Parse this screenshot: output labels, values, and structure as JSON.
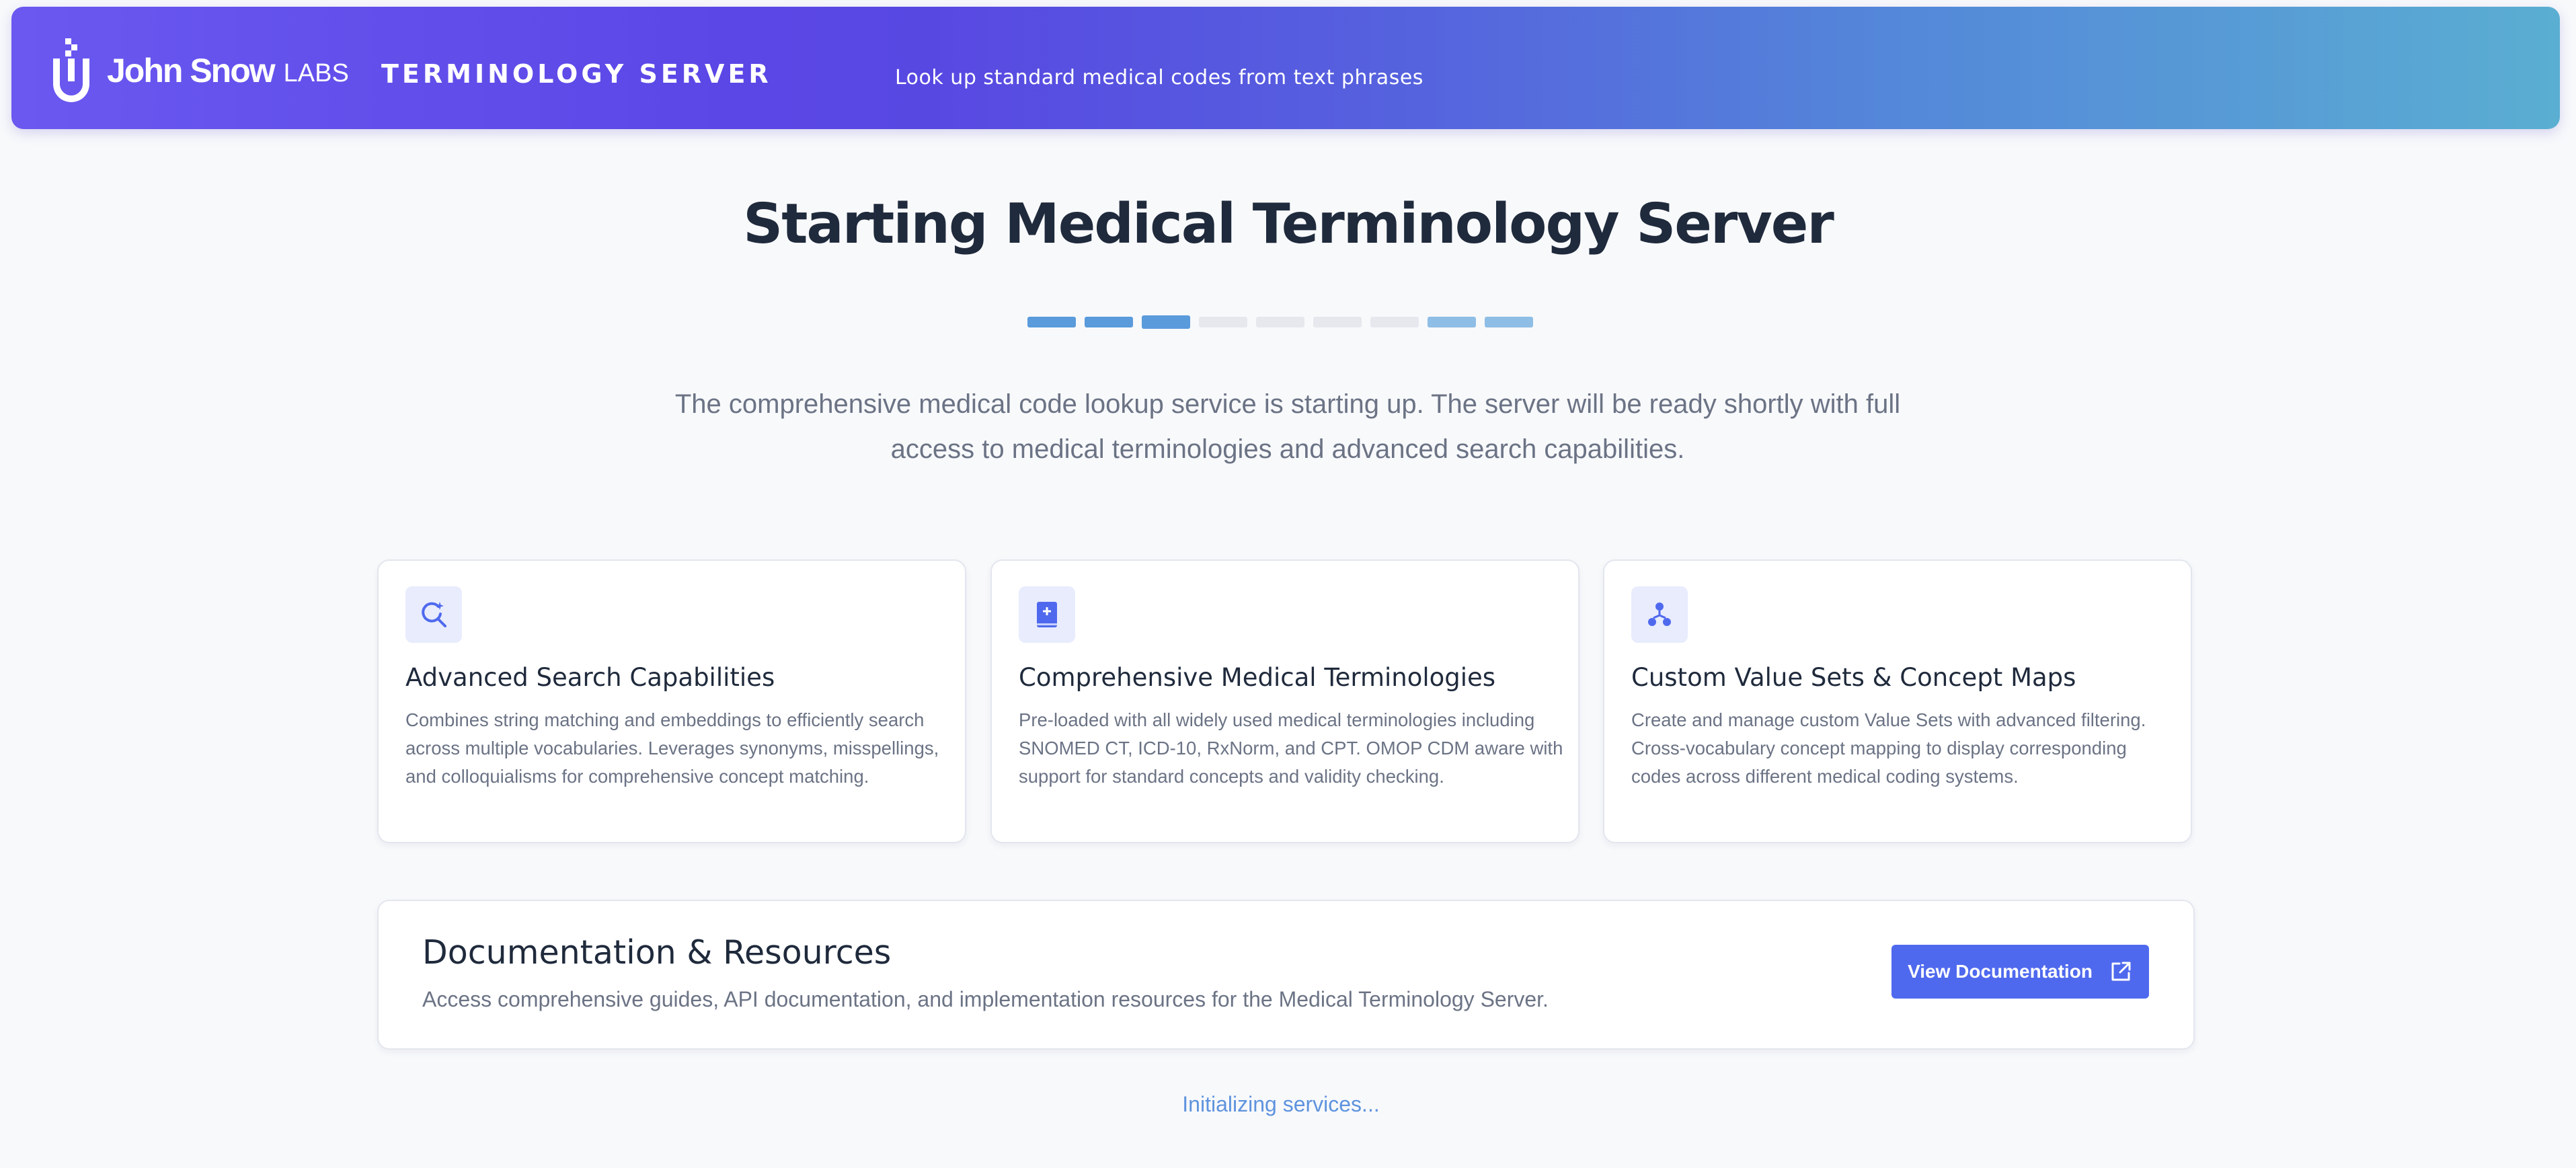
{
  "header": {
    "brand_name": "John Snow",
    "brand_labs": "LABS",
    "title": "TERMINOLOGY SERVER",
    "tagline": "Look up standard medical codes from text phrases"
  },
  "hero": {
    "title": "Starting Medical Terminology Server",
    "subtitle": "The comprehensive medical code lookup service is starting up. The server will be ready shortly with full access to medical terminologies and advanced search capabilities."
  },
  "progress": {
    "segments": [
      {
        "state": "active",
        "color": "#5a9bdc"
      },
      {
        "state": "active",
        "color": "#5a9bdc"
      },
      {
        "state": "active-current",
        "color": "#5a9bdc"
      },
      {
        "state": "inactive",
        "color": "#e6e8ee"
      },
      {
        "state": "inactive",
        "color": "#e6e8ee"
      },
      {
        "state": "inactive",
        "color": "#e6e8ee"
      },
      {
        "state": "inactive",
        "color": "#e6e8ee"
      },
      {
        "state": "partial",
        "color": "#8ebee6"
      },
      {
        "state": "partial",
        "color": "#8ebee6"
      }
    ]
  },
  "features": [
    {
      "icon": "search-sparkle-icon",
      "title": "Advanced Search Capabilities",
      "text": "Combines string matching and embeddings to efficiently search across multiple vocabularies. Leverages synonyms, misspellings, and colloquialisms for comprehensive concept matching."
    },
    {
      "icon": "medical-book-icon",
      "title": "Comprehensive Medical Terminologies",
      "text": "Pre-loaded with all widely used medical terminologies including SNOMED CT, ICD-10, RxNorm, and CPT. OMOP CDM aware with support for standard concepts and validity checking."
    },
    {
      "icon": "hierarchy-icon",
      "title": "Custom Value Sets & Concept Maps",
      "text": "Create and manage custom Value Sets with advanced filtering. Cross-vocabulary concept mapping to display corresponding codes across different medical coding systems."
    }
  ],
  "docs": {
    "title": "Documentation & Resources",
    "text": "Access comprehensive guides, API documentation, and implementation resources for the Medical Terminology Server.",
    "button_label": "View Documentation",
    "button_icon": "external-link-icon"
  },
  "status": {
    "text": "Initializing services..."
  },
  "colors": {
    "accent": "#4f69ee",
    "header_gradient_start": "#6a58f0",
    "header_gradient_end": "#5aaed2",
    "status_text": "#5e93de"
  }
}
